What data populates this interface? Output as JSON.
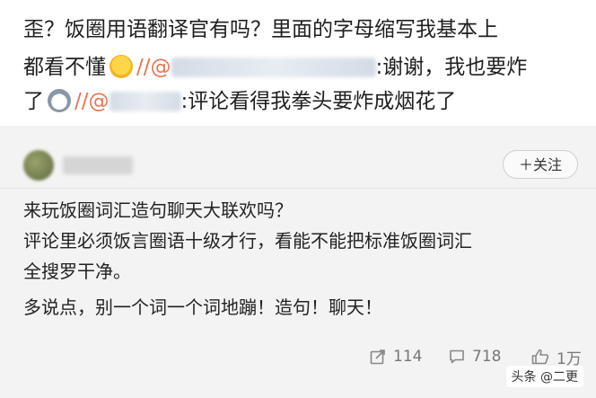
{
  "top_comment": {
    "line1": "歪？饭圈用语翻译官有吗？里面的字母缩写我基本上",
    "line2_before": "都看不懂",
    "line2_sep": "//@",
    "line2_after": ":谢谢，我也要炸",
    "line3_before": "了",
    "line3_sep": "//@",
    "line3_after": ":评论看得我拳头要炸成烟花了"
  },
  "post": {
    "follow_label": "＋关注",
    "lines": [
      "来玩饭圈词汇造句聊天大联欢吗？",
      "评论里必须饭言圈语十级才行，看能不能把标准饭圈词汇",
      "全搜罗干净。",
      "多说点，别一个词一个词地蹦！造句！聊天！"
    ],
    "actions": {
      "share_count": "114",
      "comment_count": "718",
      "like_count": "1万"
    }
  },
  "watermark": "头条 @二更",
  "colors": {
    "mention": "#eb7350",
    "card_bg": "#f3f3f3",
    "text": "#222222"
  }
}
